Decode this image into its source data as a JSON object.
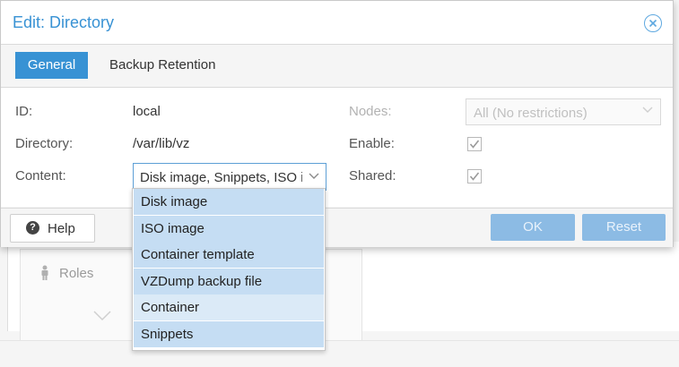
{
  "background": {
    "roles_label": "Roles"
  },
  "dialog": {
    "title": "Edit: Directory",
    "tabs": [
      {
        "label": "General",
        "active": true
      },
      {
        "label": "Backup Retention",
        "active": false
      }
    ],
    "fields": {
      "id": {
        "label": "ID:",
        "value": "local"
      },
      "directory": {
        "label": "Directory:",
        "value": "/var/lib/vz"
      },
      "content": {
        "label": "Content:",
        "value": "Disk image, Snippets, ISO image"
      },
      "nodes": {
        "label": "Nodes:",
        "value": "All (No restrictions)",
        "disabled": true
      },
      "enable": {
        "label": "Enable:",
        "checked": true
      },
      "shared": {
        "label": "Shared:",
        "checked": true
      }
    },
    "footer": {
      "help": "Help",
      "ok": "OK",
      "reset": "Reset"
    }
  },
  "content_dropdown": {
    "options": [
      {
        "label": "Disk image",
        "selected": true
      },
      {
        "label": "ISO image",
        "selected": true
      },
      {
        "label": "Container template",
        "selected": true
      },
      {
        "label": "VZDump backup file",
        "selected": true
      },
      {
        "label": "Container",
        "selected": false,
        "hover": true
      },
      {
        "label": "Snippets",
        "selected": true
      }
    ]
  },
  "colors": {
    "accent": "#3892d4",
    "selected_option": "#c5ddf3",
    "disabled_button": "#8cbbe4"
  }
}
